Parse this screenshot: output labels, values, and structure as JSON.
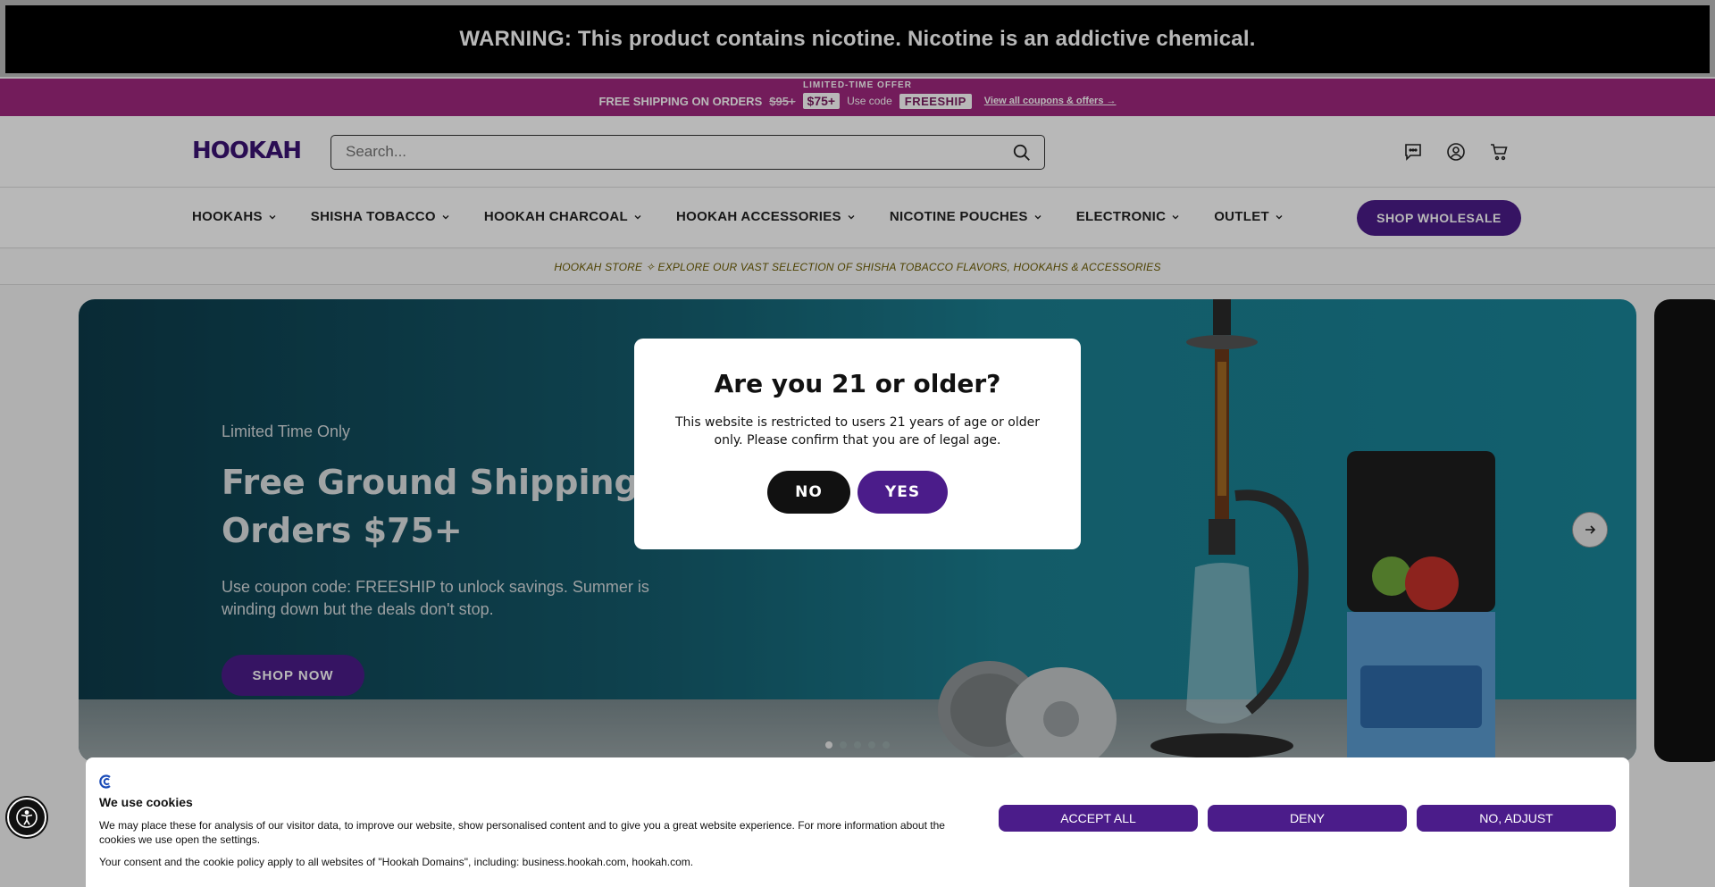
{
  "warning": {
    "text": "WARNING: This product contains nicotine. Nicotine is an addictive chemical."
  },
  "promo": {
    "eyebrow": "LIMITED-TIME OFFER",
    "lead": "FREE SHIPPING ON ORDERS",
    "old_price": "$95+",
    "new_price": "$75+",
    "use_code": "Use code",
    "code": "FREESHIP",
    "link": "View all coupons & offers →"
  },
  "header": {
    "logo": "HOOKAH",
    "search_placeholder": "Search...",
    "icons": [
      "chat-icon",
      "account-icon",
      "cart-icon"
    ]
  },
  "nav": {
    "items": [
      {
        "label": "HOOKAHS"
      },
      {
        "label": "SHISHA TOBACCO"
      },
      {
        "label": "HOOKAH CHARCOAL"
      },
      {
        "label": "HOOKAH ACCESSORIES"
      },
      {
        "label": "NICOTINE POUCHES"
      },
      {
        "label": "ELECTRONIC"
      },
      {
        "label": "OUTLET"
      }
    ],
    "wholesale": "SHOP WHOLESALE"
  },
  "tagline": "HOOKAH STORE ✧ EXPLORE OUR VAST SELECTION OF SHISHA TOBACCO FLAVORS, HOOKAHS & ACCESSORIES",
  "hero": {
    "eyebrow": "Limited Time Only",
    "title": "Free Ground Shipping On Orders $75+",
    "description": "Use coupon code: FREESHIP to unlock savings. Summer is winding down but the deals don't stop.",
    "cta": "SHOP NOW",
    "slide_count": 5,
    "active_slide": 1
  },
  "age_modal": {
    "title": "Are you 21 or older?",
    "body": "This website is restricted to users 21 years of age or older only. Please confirm that you are of legal age.",
    "no": "NO",
    "yes": "YES"
  },
  "cookie": {
    "title": "We use cookies",
    "body": "We may place these for analysis of our visitor data, to improve our website, show personalised content and to give you a great website experience. For more information about the cookies we use open the settings.",
    "consent": "Your consent and the cookie policy apply to all websites of \"Hookah Domains\", including: business.hookah.com, hookah.com.",
    "accept": "ACCEPT ALL",
    "deny": "DENY",
    "adjust": "NO, ADJUST"
  },
  "colors": {
    "brand_purple": "#4b1c8a",
    "promo_magenta": "#a0287e",
    "warning_black": "#000000"
  }
}
